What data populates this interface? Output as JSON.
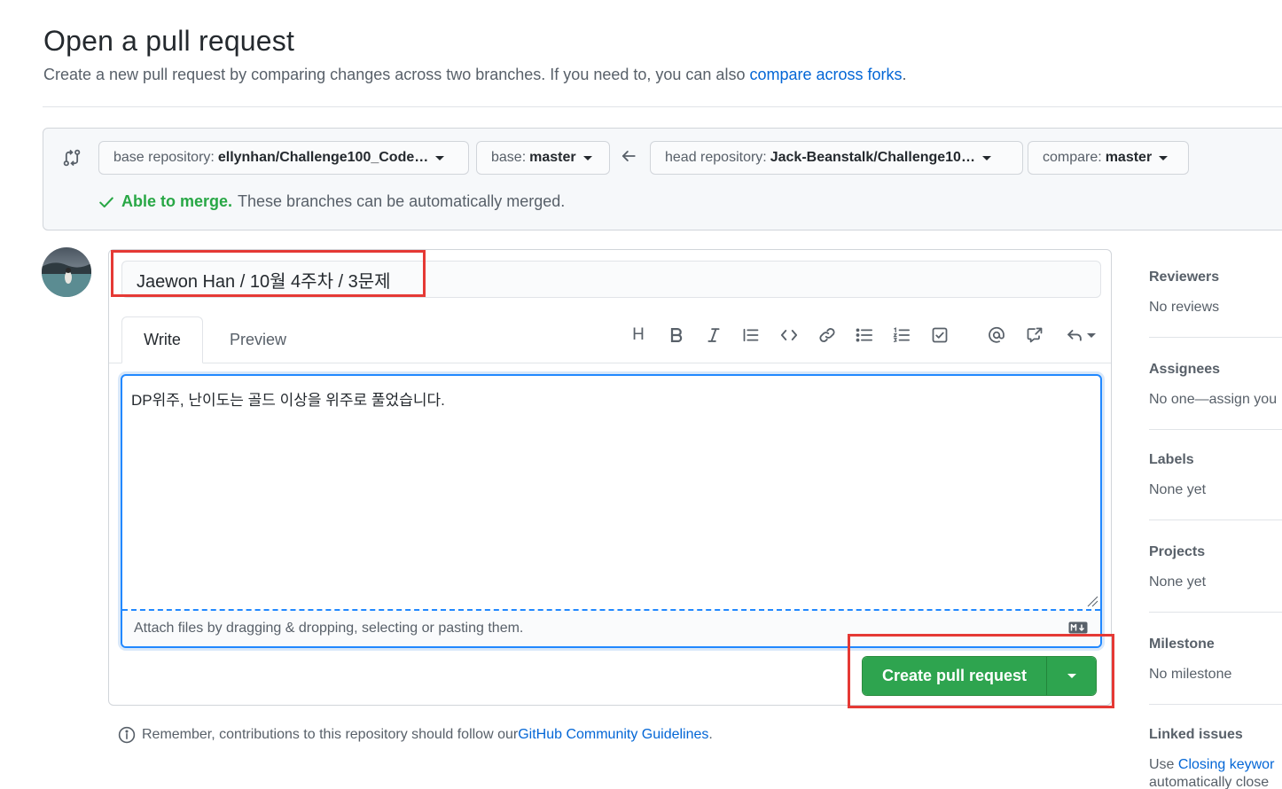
{
  "header": {
    "title": "Open a pull request",
    "subtitle_prefix": "Create a new pull request by comparing changes across two branches. If you need to, you can also ",
    "subtitle_link": "compare across forks",
    "subtitle_suffix": "."
  },
  "compare": {
    "base_repo_label": "base repository:",
    "base_repo_value": "ellynhan/Challenge100_Code…",
    "base_label": "base:",
    "base_value": "master",
    "head_repo_label": "head repository:",
    "head_repo_value": "Jack-Beanstalk/Challenge10…",
    "compare_label": "compare:",
    "compare_value": "master",
    "merge_ok": "Able to merge.",
    "merge_msg": "These branches can be automatically merged."
  },
  "pr": {
    "title_value": "Jaewon Han / 10월 4주차 / 3문제",
    "tabs": [
      "Write",
      "Preview"
    ],
    "toolbar": [
      "heading-icon",
      "bold-icon",
      "italic-icon",
      "quote-icon",
      "code-icon",
      "link-icon",
      "unordered-list-icon",
      "ordered-list-icon",
      "tasklist-icon",
      "mention-icon",
      "cross-reference-icon",
      "saved-replies-icon"
    ],
    "heading_glyph": "H",
    "body_value": "DP위주, 난이도는 골드 이상을 위주로 풀었습니다.",
    "drop_hint": "Attach files by dragging & dropping, selecting or pasting them.",
    "create_label": "Create pull request"
  },
  "footer": {
    "prefix": "Remember, contributions to this repository should follow our ",
    "link": "GitHub Community Guidelines",
    "suffix": "."
  },
  "sidebar": [
    {
      "heading": "Reviewers",
      "value": "No reviews"
    },
    {
      "heading": "Assignees",
      "value": "No one—assign you"
    },
    {
      "heading": "Labels",
      "value": "None yet"
    },
    {
      "heading": "Projects",
      "value": "None yet"
    },
    {
      "heading": "Milestone",
      "value": "No milestone"
    },
    {
      "heading": "Linked issues",
      "value_prefix": "Use ",
      "value_link": "Closing keywor",
      "value_line2": "automatically close"
    }
  ],
  "colors": {
    "accent": "#0366d6",
    "success": "#28a745",
    "button_green": "#2ea44f",
    "highlight": "#e53935"
  }
}
